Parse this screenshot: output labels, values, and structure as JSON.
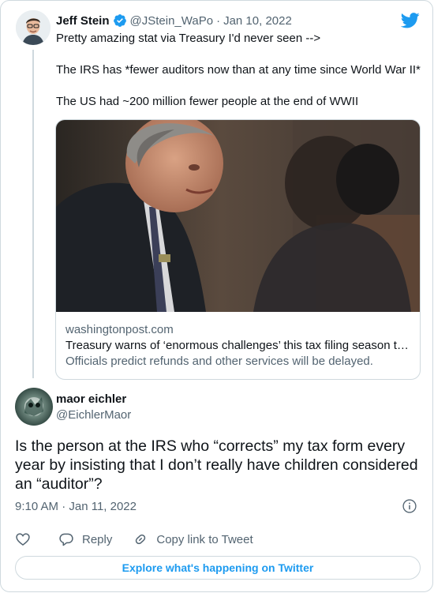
{
  "parent_tweet": {
    "author_name": "Jeff Stein",
    "handle": "@JStein_WaPo",
    "separator": "·",
    "date": "Jan 10, 2022",
    "lines": [
      "Pretty amazing stat via Treasury I'd never seen -->",
      "The IRS has *fewer auditors now than at any time since World War II*",
      "The US had ~200 million fewer people at the end of WWII"
    ],
    "link_card": {
      "domain": "washingtonpost.com",
      "title": "Treasury warns of ‘enormous challenges’ this tax filing season t…",
      "description": "Officials predict refunds and other services will be delayed."
    }
  },
  "main_tweet": {
    "author_name": "maor eichler",
    "handle": "@EichlerMaor",
    "text": "Is the person at the IRS who “corrects” my tax form every year by insisting that I don’t really have children considered an “auditor”?",
    "timestamp": "9:10 AM · Jan 11, 2022"
  },
  "actions": {
    "reply_label": "Reply",
    "copy_link_label": "Copy link to Tweet"
  },
  "explore_label": "Explore what's happening on Twitter",
  "colors": {
    "accent": "#1d9bf0",
    "text": "#0f1419",
    "muted": "#536471",
    "border": "#cfd9de"
  },
  "icons": [
    "twitter-bird-icon",
    "verified-badge-icon",
    "info-icon",
    "heart-icon",
    "reply-icon",
    "link-icon"
  ]
}
